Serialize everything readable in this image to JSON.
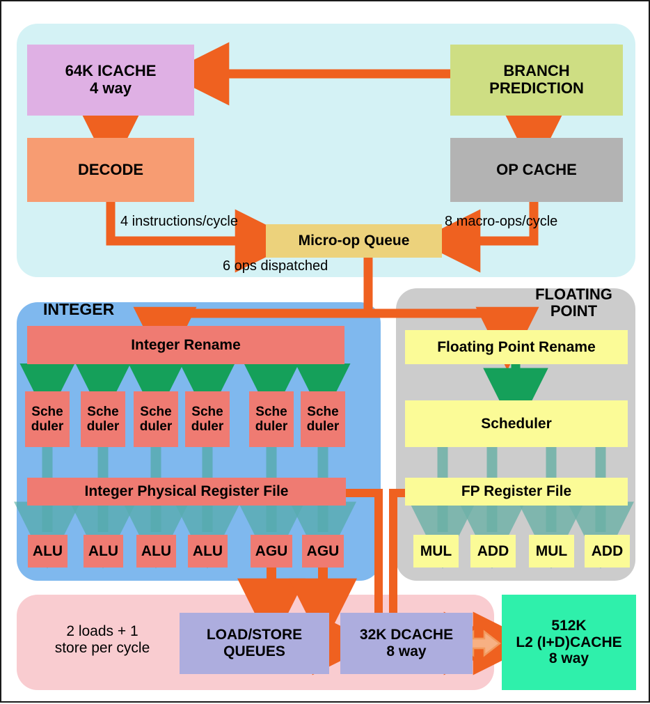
{
  "diagram": {
    "title": "CPU Core Microarchitecture Block Diagram",
    "colors": {
      "frontend_panel": "#d4f2f5",
      "integer_panel": "#7fb8ee",
      "fp_panel": "#cccccc",
      "memory_panel": "#f9ccd0",
      "icache": "#dfb0e4",
      "decode": "#f79c72",
      "branch_prediction": "#cede83",
      "op_cache": "#b3b3b3",
      "uop_queue": "#ecd27c",
      "integer_block": "#ef7b72",
      "fp_block": "#fbfb97",
      "lsq_block": "#adadde",
      "l2_block": "#2ff0ab",
      "orange_arrow": "#ef6120",
      "green_arrow": "#15a05a",
      "teal_arrow": "#4aa79a",
      "l2_arrow": "#f7a濃"
    },
    "panels": {
      "frontend": {
        "name": "front-end-panel"
      },
      "integer": {
        "title": "INTEGER"
      },
      "floating_point": {
        "title": "FLOATING\nPOINT"
      },
      "memory": {
        "name": "memory-panel"
      }
    },
    "frontend": {
      "icache": "64K ICACHE\n4 way",
      "decode": "DECODE",
      "branch_prediction": "BRANCH\nPREDICTION",
      "op_cache": "OP CACHE",
      "uop_queue": "Micro-op Queue",
      "label_decode_rate": "4 instructions/cycle",
      "label_opcache_rate": "8 macro-ops/cycle",
      "label_dispatch": "6 ops dispatched"
    },
    "integer": {
      "rename": "Integer Rename",
      "schedulers": [
        "Sche\nduler",
        "Sche\nduler",
        "Sche\nduler",
        "Sche\nduler",
        "Sche\nduler",
        "Sche\nduler"
      ],
      "register_file": "Integer Physical Register File",
      "execution_units": [
        "ALU",
        "ALU",
        "ALU",
        "ALU",
        "AGU",
        "AGU"
      ]
    },
    "floating_point": {
      "rename": "Floating Point Rename",
      "scheduler": "Scheduler",
      "register_file": "FP Register File",
      "execution_units": [
        "MUL",
        "ADD",
        "MUL",
        "ADD"
      ]
    },
    "memory": {
      "label_loads_stores": "2 loads + 1\nstore  per cycle",
      "load_store_queues": "LOAD/STORE\nQUEUES",
      "dcache": "32K DCACHE\n8 way"
    },
    "l2_cache": "512K\nL2 (I+D)CACHE\n8 way"
  }
}
